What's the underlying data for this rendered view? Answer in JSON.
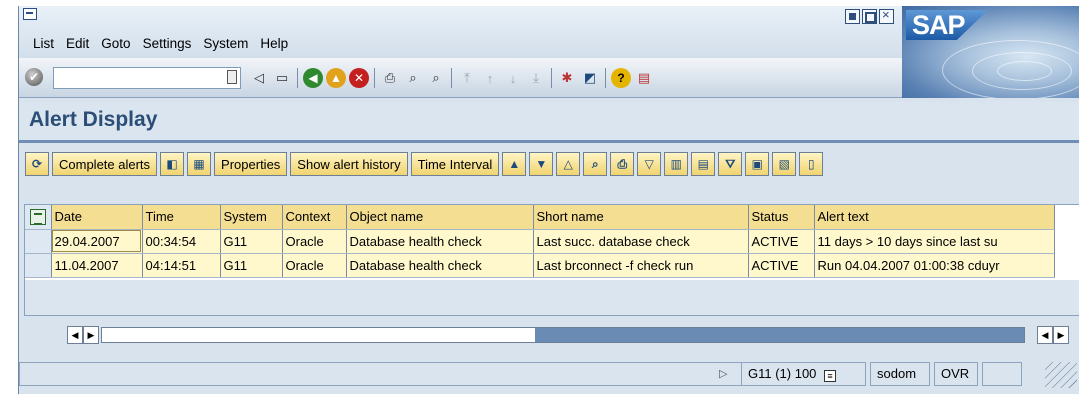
{
  "menu": {
    "items": [
      "List",
      "Edit",
      "Goto",
      "Settings",
      "System",
      "Help"
    ]
  },
  "logo": {
    "text": "SAP"
  },
  "toolbar": {
    "command_value": "",
    "icons": [
      "enter-icon",
      "back-icon",
      "exit-icon",
      "cancel-icon",
      "print-icon",
      "find-icon",
      "find-next-icon",
      "first-page-icon",
      "previous-page-icon",
      "next-page-icon",
      "last-page-icon",
      "create-session-icon",
      "shortcut-icon",
      "help-icon",
      "layout-icon"
    ]
  },
  "title": "Alert Display",
  "app_toolbar": {
    "complete_alerts": "Complete alerts",
    "properties": "Properties",
    "show_alert_history": "Show alert history",
    "time_interval": "Time Interval"
  },
  "table": {
    "columns": [
      "Date",
      "Time",
      "System",
      "Context",
      "Object name",
      "Short name",
      "Status",
      "Alert text"
    ],
    "rows": [
      [
        "29.04.2007",
        "00:34:54",
        "G11",
        "Oracle",
        "Database health check",
        "Last succ. database check",
        "ACTIVE",
        "11 days > 10 days since last su"
      ],
      [
        "11.04.2007",
        "04:14:51",
        "G11",
        "Oracle",
        "Database health check",
        "Last brconnect -f check run",
        "ACTIVE",
        "Run 04.04.2007 01:00:38 cduyr"
      ]
    ]
  },
  "scrollbar": {
    "position": 0.47
  },
  "status": {
    "system": "G11 (1) 100",
    "host": "sodom",
    "mode": "OVR"
  }
}
